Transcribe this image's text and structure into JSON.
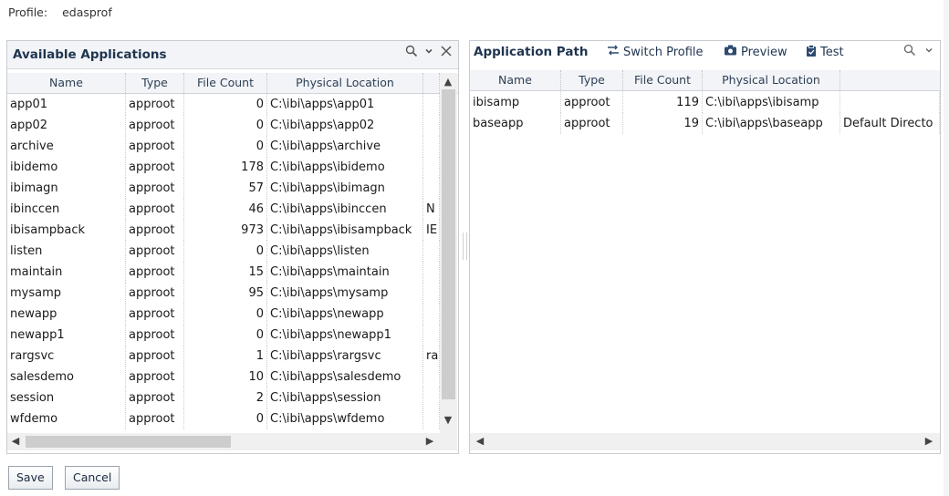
{
  "profile": {
    "label": "Profile:",
    "value": "edasprof"
  },
  "left": {
    "title": "Available Applications",
    "columns": [
      "Name",
      "Type",
      "File Count",
      "Physical Location"
    ],
    "rows": [
      [
        "app01",
        "approot",
        "0",
        "C:\\ibi\\apps\\app01",
        ""
      ],
      [
        "app02",
        "approot",
        "0",
        "C:\\ibi\\apps\\app02",
        ""
      ],
      [
        "archive",
        "approot",
        "0",
        "C:\\ibi\\apps\\archive",
        ""
      ],
      [
        "ibidemo",
        "approot",
        "178",
        "C:\\ibi\\apps\\ibidemo",
        ""
      ],
      [
        "ibimagn",
        "approot",
        "57",
        "C:\\ibi\\apps\\ibimagn",
        ""
      ],
      [
        "ibinccen",
        "approot",
        "46",
        "C:\\ibi\\apps\\ibinccen",
        "N"
      ],
      [
        "ibisampback",
        "approot",
        "973",
        "C:\\ibi\\apps\\ibisampback",
        "IE"
      ],
      [
        "listen",
        "approot",
        "0",
        "C:\\ibi\\apps\\listen",
        ""
      ],
      [
        "maintain",
        "approot",
        "15",
        "C:\\ibi\\apps\\maintain",
        ""
      ],
      [
        "mysamp",
        "approot",
        "95",
        "C:\\ibi\\apps\\mysamp",
        ""
      ],
      [
        "newapp",
        "approot",
        "0",
        "C:\\ibi\\apps\\newapp",
        ""
      ],
      [
        "newapp1",
        "approot",
        "0",
        "C:\\ibi\\apps\\newapp1",
        ""
      ],
      [
        "rargsvc",
        "approot",
        "1",
        "C:\\ibi\\apps\\rargsvc",
        "ra"
      ],
      [
        "salesdemo",
        "approot",
        "10",
        "C:\\ibi\\apps\\salesdemo",
        ""
      ],
      [
        "session",
        "approot",
        "2",
        "C:\\ibi\\apps\\session",
        ""
      ],
      [
        "wfdemo",
        "approot",
        "0",
        "C:\\ibi\\apps\\wfdemo",
        ""
      ]
    ]
  },
  "right": {
    "title": "Application Path",
    "tools": {
      "switch_profile": "Switch Profile",
      "preview": "Preview",
      "test": "Test"
    },
    "columns": [
      "Name",
      "Type",
      "File Count",
      "Physical Location"
    ],
    "rows": [
      [
        "ibisamp",
        "approot",
        "119",
        "C:\\ibi\\apps\\ibisamp",
        ""
      ],
      [
        "baseapp",
        "approot",
        "19",
        "C:\\ibi\\apps\\baseapp",
        "Default Directo"
      ]
    ]
  },
  "buttons": {
    "save": "Save",
    "cancel": "Cancel"
  },
  "icons": [
    "search-icon",
    "chevron-down-icon",
    "close-icon",
    "switch-icon",
    "camera-icon",
    "clipboard-icon"
  ]
}
